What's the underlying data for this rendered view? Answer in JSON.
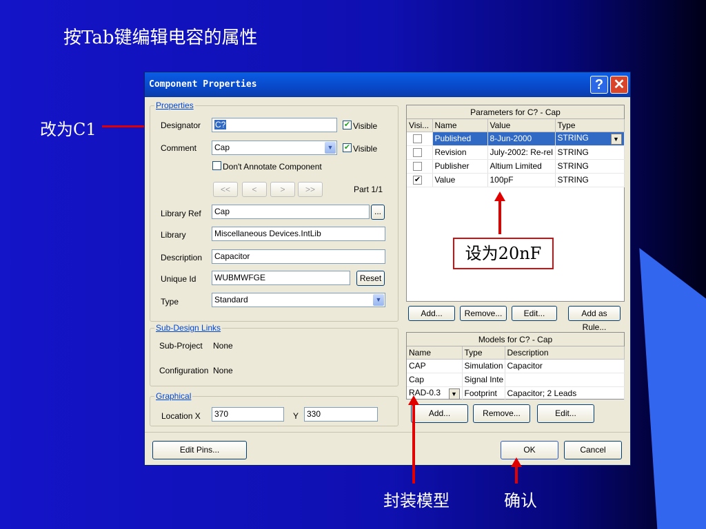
{
  "slide": {
    "title": "按Tab键编辑电容的属性",
    "annotation_designator": "改为C1",
    "annotation_value": "设为20nF",
    "annotation_footprint": "封装模型",
    "annotation_ok": "确认"
  },
  "dialog": {
    "title": "Component Properties",
    "help_button": "?",
    "close_button": "✕",
    "properties": {
      "legend": "Properties",
      "designator_label": "Designator",
      "designator_value": "C?",
      "designator_visible_label": "Visible",
      "designator_visible": true,
      "comment_label": "Comment",
      "comment_value": "Cap",
      "comment_visible_label": "Visible",
      "comment_visible": true,
      "dont_annotate_label": "Don't Annotate Component",
      "dont_annotate": false,
      "nav_first": "<<",
      "nav_prev": "<",
      "nav_next": ">",
      "nav_last": ">>",
      "part_label": "Part 1/1",
      "library_ref_label": "Library Ref",
      "library_ref_value": "Cap",
      "browse_button": "...",
      "library_label": "Library",
      "library_value": "Miscellaneous Devices.IntLib",
      "description_label": "Description",
      "description_value": "Capacitor",
      "unique_id_label": "Unique Id",
      "unique_id_value": "WUBMWFGE",
      "reset_button": "Reset",
      "type_label": "Type",
      "type_value": "Standard"
    },
    "sub_design": {
      "legend": "Sub-Design Links",
      "sub_project_label": "Sub-Project",
      "sub_project_value": "None",
      "configuration_label": "Configuration",
      "configuration_value": "None"
    },
    "graphical": {
      "legend": "Graphical",
      "location_x_label": "Location X",
      "location_x_value": "370",
      "location_y_label": "Y",
      "location_y_value": "330"
    },
    "parameters": {
      "caption": "Parameters for C? - Cap",
      "columns": [
        "Visi...",
        "Name",
        "Value",
        "Type"
      ],
      "rows": [
        {
          "visible": false,
          "name": "Published",
          "value": "8-Jun-2000",
          "type": "STRING",
          "selected": true
        },
        {
          "visible": false,
          "name": "Revision",
          "value": "July-2002: Re-rel",
          "type": "STRING",
          "selected": false
        },
        {
          "visible": false,
          "name": "Publisher",
          "value": "Altium Limited",
          "type": "STRING",
          "selected": false
        },
        {
          "visible": true,
          "name": "Value",
          "value": "100pF",
          "type": "STRING",
          "selected": false
        }
      ],
      "add_button": "Add...",
      "remove_button": "Remove...",
      "edit_button": "Edit...",
      "add_rule_button": "Add as Rule..."
    },
    "models": {
      "caption": "Models for C? - Cap",
      "columns": [
        "Name",
        "Type",
        "Description"
      ],
      "rows": [
        {
          "name": "CAP",
          "type": "Simulation",
          "description": "Capacitor"
        },
        {
          "name": "Cap",
          "type": "Signal Inte",
          "description": ""
        },
        {
          "name": "RAD-0.3",
          "type": "Footprint",
          "description": "Capacitor; 2 Leads"
        }
      ],
      "add_button": "Add...",
      "remove_button": "Remove...",
      "edit_button": "Edit..."
    },
    "edit_pins_button": "Edit Pins...",
    "ok_button": "OK",
    "cancel_button": "Cancel"
  },
  "colors": {
    "annotation_arrow": "#e00000",
    "selection": "#316ac5",
    "titlebar": "#0a5ee6"
  }
}
